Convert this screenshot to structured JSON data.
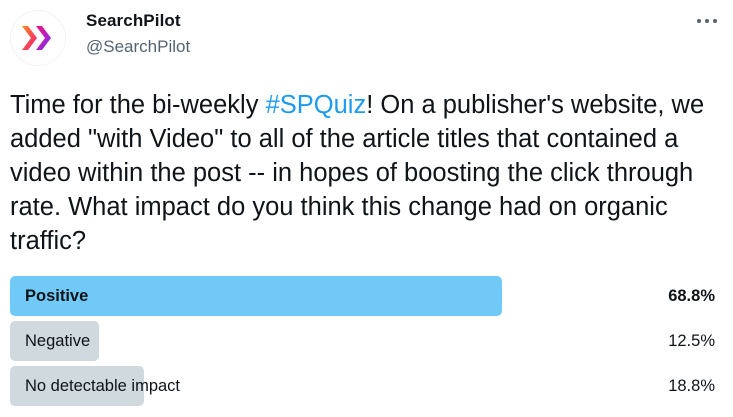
{
  "author": {
    "display_name": "SearchPilot",
    "handle": "@SearchPilot",
    "avatar_icon": "searchpilot-chevron-logo"
  },
  "more_icon": "more-options-icon",
  "tweet": {
    "text_before": "Time for the bi-weekly ",
    "hashtag": "#SPQuiz",
    "text_after": "! On a publisher's website, we added \"with Video\" to all of the article titles that contained a video within the post -- in hopes of boosting the click through rate. What impact do you think this change had on organic traffic?"
  },
  "colors": {
    "hashtag": "#1d9bf0",
    "winner_bar": "#71c9f8",
    "other_bar": "#cfd9de",
    "logo_pink": "#f0147f",
    "logo_orange": "#ff8a1f",
    "logo_purple": "#7b2ff7"
  },
  "poll": {
    "options": [
      {
        "label": "Positive",
        "percent_text": "68.8%",
        "percent": 68.8,
        "winner": true
      },
      {
        "label": "Negative",
        "percent_text": "12.5%",
        "percent": 12.5,
        "winner": false
      },
      {
        "label": "No detectable impact",
        "percent_text": "18.8%",
        "percent": 18.8,
        "winner": false
      }
    ]
  }
}
